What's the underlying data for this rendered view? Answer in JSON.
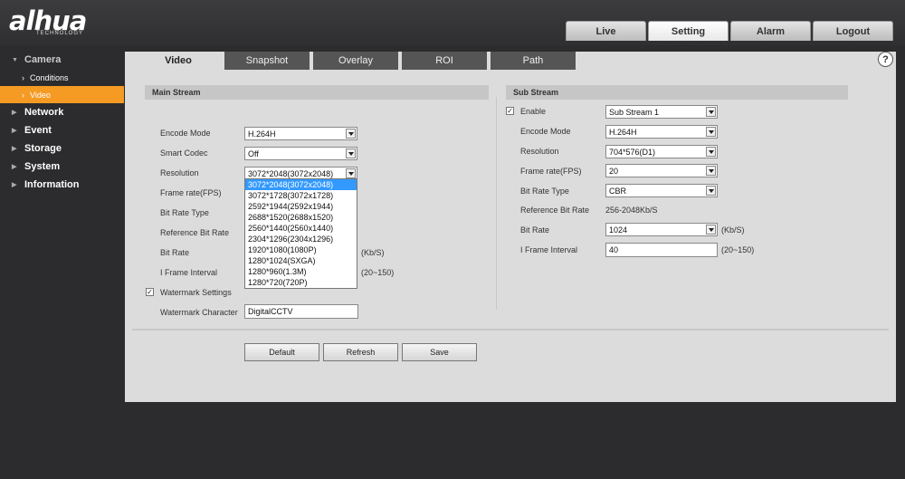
{
  "brand": {
    "logo": "alhua",
    "tagline": "TECHNOLOGY"
  },
  "top_tabs": [
    {
      "label": "Live"
    },
    {
      "label": "Setting"
    },
    {
      "label": "Alarm"
    },
    {
      "label": "Logout"
    }
  ],
  "sidebar": {
    "camera": "Camera",
    "conditions": "Conditions",
    "video": "Video",
    "network": "Network",
    "event": "Event",
    "storage": "Storage",
    "system": "System",
    "information": "Information"
  },
  "sub_tabs": [
    {
      "label": "Video"
    },
    {
      "label": "Snapshot"
    },
    {
      "label": "Overlay"
    },
    {
      "label": "ROI"
    },
    {
      "label": "Path"
    }
  ],
  "help": "?",
  "main_stream": {
    "title": "Main Stream",
    "encode_mode_label": "Encode Mode",
    "encode_mode": "H.264H",
    "smart_codec_label": "Smart Codec",
    "smart_codec": "Off",
    "resolution_label": "Resolution",
    "resolution": "3072*2048(3072x2048)",
    "frame_rate_label": "Frame rate(FPS)",
    "bit_rate_type_label": "Bit Rate Type",
    "reference_bit_rate_label": "Reference Bit Rate",
    "bit_rate_label": "Bit Rate",
    "bit_rate_unit": "(Kb/S)",
    "i_frame_label": "I Frame Interval",
    "i_frame_range": "(20~150)",
    "watermark_settings_label": "Watermark Settings",
    "watermark_checked": "✓",
    "watermark_character_label": "Watermark Character",
    "watermark_character": "DigitalCCTV",
    "resolution_options": [
      "3072*2048(3072x2048)",
      "3072*1728(3072x1728)",
      "2592*1944(2592x1944)",
      "2688*1520(2688x1520)",
      "2560*1440(2560x1440)",
      "2304*1296(2304x1296)",
      "1920*1080(1080P)",
      "1280*1024(SXGA)",
      "1280*960(1.3M)",
      "1280*720(720P)"
    ]
  },
  "sub_stream": {
    "title": "Sub Stream",
    "enable_label": "Enable",
    "enable_checked": "✓",
    "enable_value": "Sub Stream 1",
    "encode_mode_label": "Encode Mode",
    "encode_mode": "H.264H",
    "resolution_label": "Resolution",
    "resolution": "704*576(D1)",
    "frame_rate_label": "Frame rate(FPS)",
    "frame_rate": "20",
    "bit_rate_type_label": "Bit Rate Type",
    "bit_rate_type": "CBR",
    "reference_bit_rate_label": "Reference Bit Rate",
    "reference_bit_rate": "256-2048Kb/S",
    "bit_rate_label": "Bit Rate",
    "bit_rate": "1024",
    "bit_rate_unit": "(Kb/S)",
    "i_frame_label": "I Frame Interval",
    "i_frame": "40",
    "i_frame_range": "(20~150)"
  },
  "buttons": {
    "default": "Default",
    "refresh": "Refresh",
    "save": "Save"
  }
}
